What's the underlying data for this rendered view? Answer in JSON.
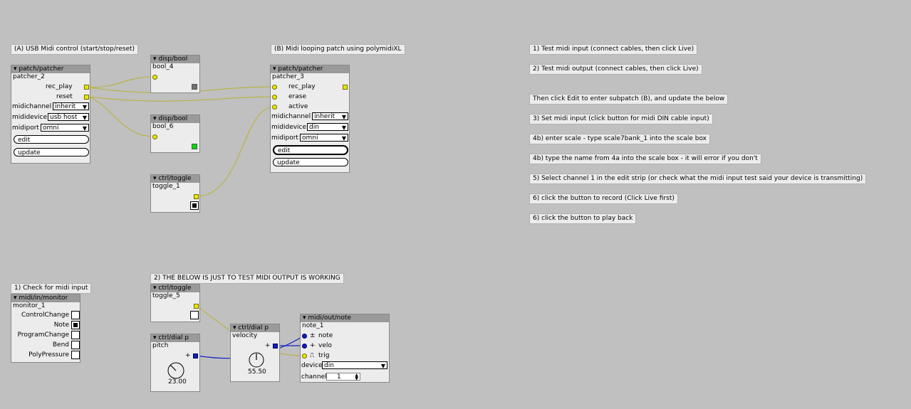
{
  "comments": {
    "usb_midi": "(A) USB Midi control (start/stop/reset)",
    "midi_looping": "(B) Midi looping patch using polymidiXL",
    "check_midi_input": "1) Check for midi input",
    "test_output": "2) THE BELOW IS JUST TO TEST MIDI OUTPUT IS WORKING",
    "steps": [
      "1) Test midi input (connect cables, then click Live)",
      "2) Test midi output (connect cables, then click Live)",
      "Then click Edit to enter subpatch (B), and update the below",
      "3) Set midi input (click button for midi DIN cable input)",
      "4b) enter scale - type scale7bank_1 into the scale box",
      "4b) type the name from 4a into the scale box - it will error if you don't",
      "5) Select channel 1 in the edit strip  (or check what the midi input test said your device is transmitting)",
      "6) click the button to record (Click Live first)",
      "6) click the button to play back"
    ]
  },
  "patcher_2": {
    "type": "patch/patcher",
    "name": "patcher_2",
    "rec_play": "rec_play",
    "reset": "reset",
    "midichannel_label": "midichannel",
    "midichannel_value": "inherit",
    "mididevice_label": "mididevice",
    "mididevice_value": "usb host",
    "midiport_label": "midiport",
    "midiport_value": "omni",
    "edit": "edit",
    "update": "update"
  },
  "patcher_3": {
    "type": "patch/patcher",
    "name": "patcher_3",
    "rec_play": "rec_play",
    "erase": "erase",
    "active": "active",
    "midichannel_label": "midichannel",
    "midichannel_value": "inherit",
    "mididevice_label": "mididevice",
    "mididevice_value": "din",
    "midiport_label": "midiport",
    "midiport_value": "omni",
    "edit": "edit",
    "update": "update"
  },
  "bool_4": {
    "type": "disp/bool",
    "name": "bool_4",
    "state": false,
    "color": "#707070"
  },
  "bool_6": {
    "type": "disp/bool",
    "name": "bool_6",
    "state": true,
    "color": "#00dd00"
  },
  "toggle_1": {
    "type": "ctrl/toggle",
    "name": "toggle_1",
    "state": true
  },
  "toggle_5": {
    "type": "ctrl/toggle",
    "name": "toggle_5",
    "state": false
  },
  "monitor_1": {
    "type": "midi/in/monitor",
    "name": "monitor_1",
    "items": [
      {
        "label": "ControlChange",
        "on": false
      },
      {
        "label": "Note",
        "on": true
      },
      {
        "label": "ProgramChange",
        "on": false
      },
      {
        "label": "Bend",
        "on": false
      },
      {
        "label": "PolyPressure",
        "on": false
      }
    ]
  },
  "pitch": {
    "type": "ctrl/dial p",
    "name": "pitch",
    "sign": "+",
    "value": "23.00"
  },
  "velocity": {
    "type": "ctrl/dial p",
    "name": "velocity",
    "sign": "+",
    "value": "55.50"
  },
  "note_1": {
    "type": "midi/out/note",
    "name": "note_1",
    "note": "note",
    "note_sign": "±",
    "velo": "velo",
    "velo_sign": "+",
    "trig": "trig",
    "trig_sign": "⎍",
    "device_label": "device",
    "device_value": "din",
    "channel_label": "channel",
    "channel_value": "1"
  },
  "colors": {
    "wire_yellow": "#b8b030",
    "wire_blue": "#1020c0",
    "background": "#c0c0c0"
  }
}
